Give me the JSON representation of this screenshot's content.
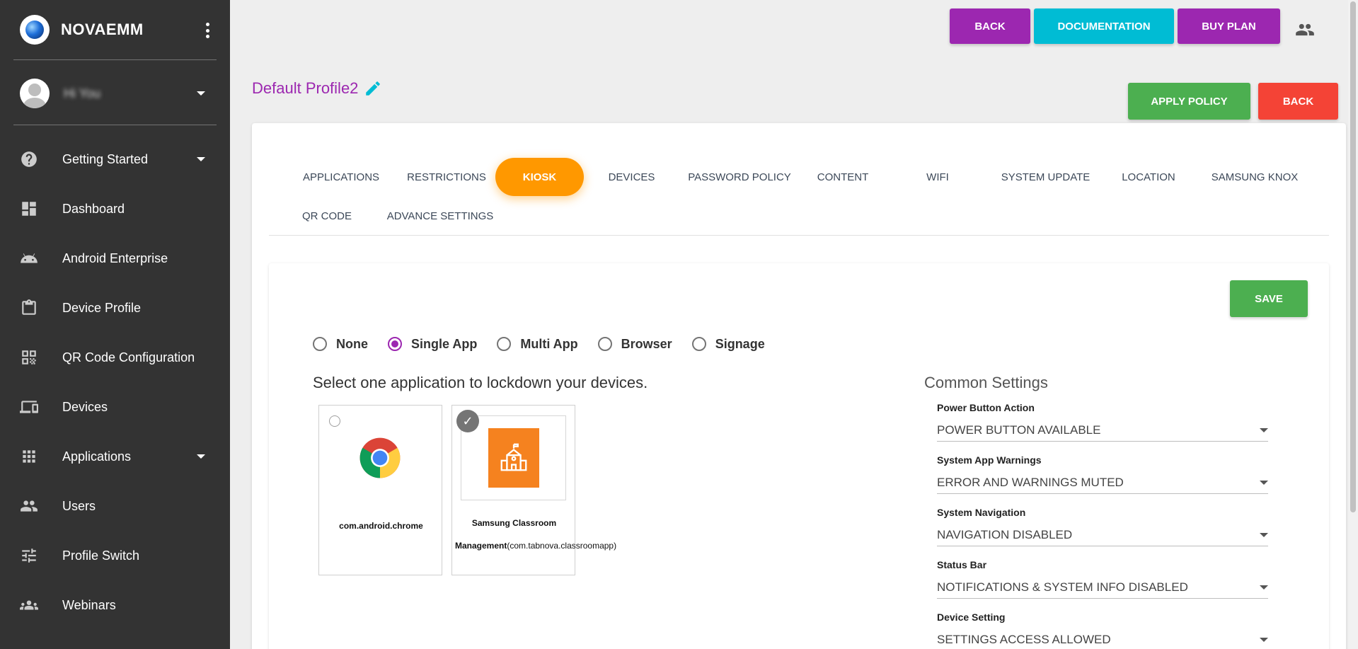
{
  "brand": {
    "name": "NOVAEMM"
  },
  "user": {
    "name": "Hi You"
  },
  "sidebar": {
    "items": [
      {
        "label": "Getting Started",
        "icon": "help-icon"
      },
      {
        "label": "Dashboard",
        "icon": "dashboard-icon"
      },
      {
        "label": "Android Enterprise",
        "icon": "android-icon"
      },
      {
        "label": "Device Profile",
        "icon": "clipboard-icon"
      },
      {
        "label": "QR Code Configuration",
        "icon": "qr-code-icon"
      },
      {
        "label": "Devices",
        "icon": "devices-icon"
      },
      {
        "label": "Applications",
        "icon": "apps-icon"
      },
      {
        "label": "Users",
        "icon": "people-icon"
      },
      {
        "label": "Profile Switch",
        "icon": "tune-icon"
      },
      {
        "label": "Webinars",
        "icon": "groups-icon"
      }
    ]
  },
  "topbar": {
    "back_label": "BACK",
    "documentation_label": "DOCUMENTATION",
    "buy_plan_label": "BUY PLAN",
    "colors": {
      "back": "#9c27b0",
      "documentation": "#00bcd4",
      "buy_plan": "#9c27b0"
    }
  },
  "profile": {
    "title": "Default Profile2",
    "apply_policy_label": "APPLY POLICY",
    "back_label": "BACK",
    "colors": {
      "apply": "#4caf50",
      "back": "#f44336"
    }
  },
  "tabs": [
    {
      "label": "APPLICATIONS"
    },
    {
      "label": "RESTRICTIONS"
    },
    {
      "label": "KIOSK"
    },
    {
      "label": "DEVICES"
    },
    {
      "label": "PASSWORD POLICY"
    },
    {
      "label": "CONTENT"
    },
    {
      "label": "WIFI"
    },
    {
      "label": "SYSTEM UPDATE"
    },
    {
      "label": "LOCATION"
    },
    {
      "label": "SAMSUNG KNOX"
    },
    {
      "label": "QR CODE"
    },
    {
      "label": "ADVANCE SETTINGS"
    }
  ],
  "kiosk": {
    "save_label": "SAVE",
    "modes": [
      {
        "label": "None"
      },
      {
        "label": "Single App"
      },
      {
        "label": "Multi App"
      },
      {
        "label": "Browser"
      },
      {
        "label": "Signage"
      }
    ],
    "selected_mode": "Single App",
    "heading": "Select one application to lockdown your devices.",
    "apps": [
      {
        "name": "com.android.chrome",
        "selected": false
      },
      {
        "name_bold": "Samsung Classroom Management",
        "name_pkg": "(com.tabnova.classroomapp)",
        "selected": true
      }
    ],
    "common_title": "Common Settings",
    "settings": [
      {
        "label": "Power Button Action",
        "value": "POWER BUTTON AVAILABLE"
      },
      {
        "label": "System App Warnings",
        "value": "ERROR AND WARNINGS MUTED"
      },
      {
        "label": "System Navigation",
        "value": "NAVIGATION DISABLED"
      },
      {
        "label": "Status Bar",
        "value": "NOTIFICATIONS & SYSTEM INFO DISABLED"
      },
      {
        "label": "Device Setting",
        "value": "SETTINGS ACCESS ALLOWED"
      }
    ]
  }
}
